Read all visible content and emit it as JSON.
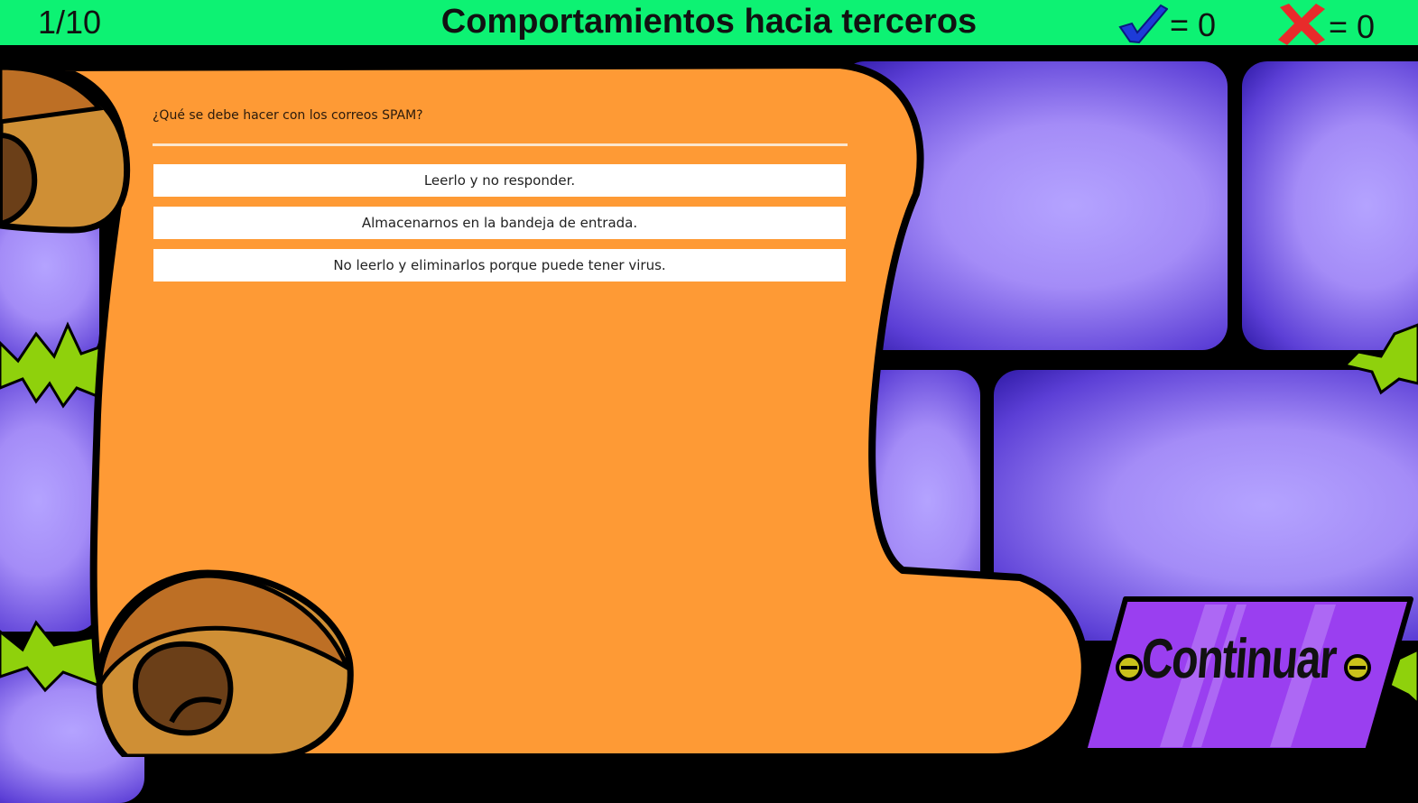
{
  "header": {
    "progress": "1/10",
    "title": "Comportamientos hacia terceros",
    "correct_count": "= 0",
    "wrong_count": "= 0"
  },
  "quiz": {
    "question": "¿Qué se debe hacer con los correos SPAM?",
    "options": [
      "Leerlo y no responder.",
      "Almacenarnos en la bandeja de entrada.",
      "No leerlo y eliminarlos porque puede tener virus."
    ]
  },
  "continue_button": {
    "label": "Continuar"
  },
  "icons": {
    "correct": "checkmark-icon",
    "wrong": "cross-icon"
  },
  "colors": {
    "header_bg": "#0df273",
    "scroll": "#fe9a35",
    "brick": "#a48cf7",
    "button": "#9a3ff0"
  }
}
